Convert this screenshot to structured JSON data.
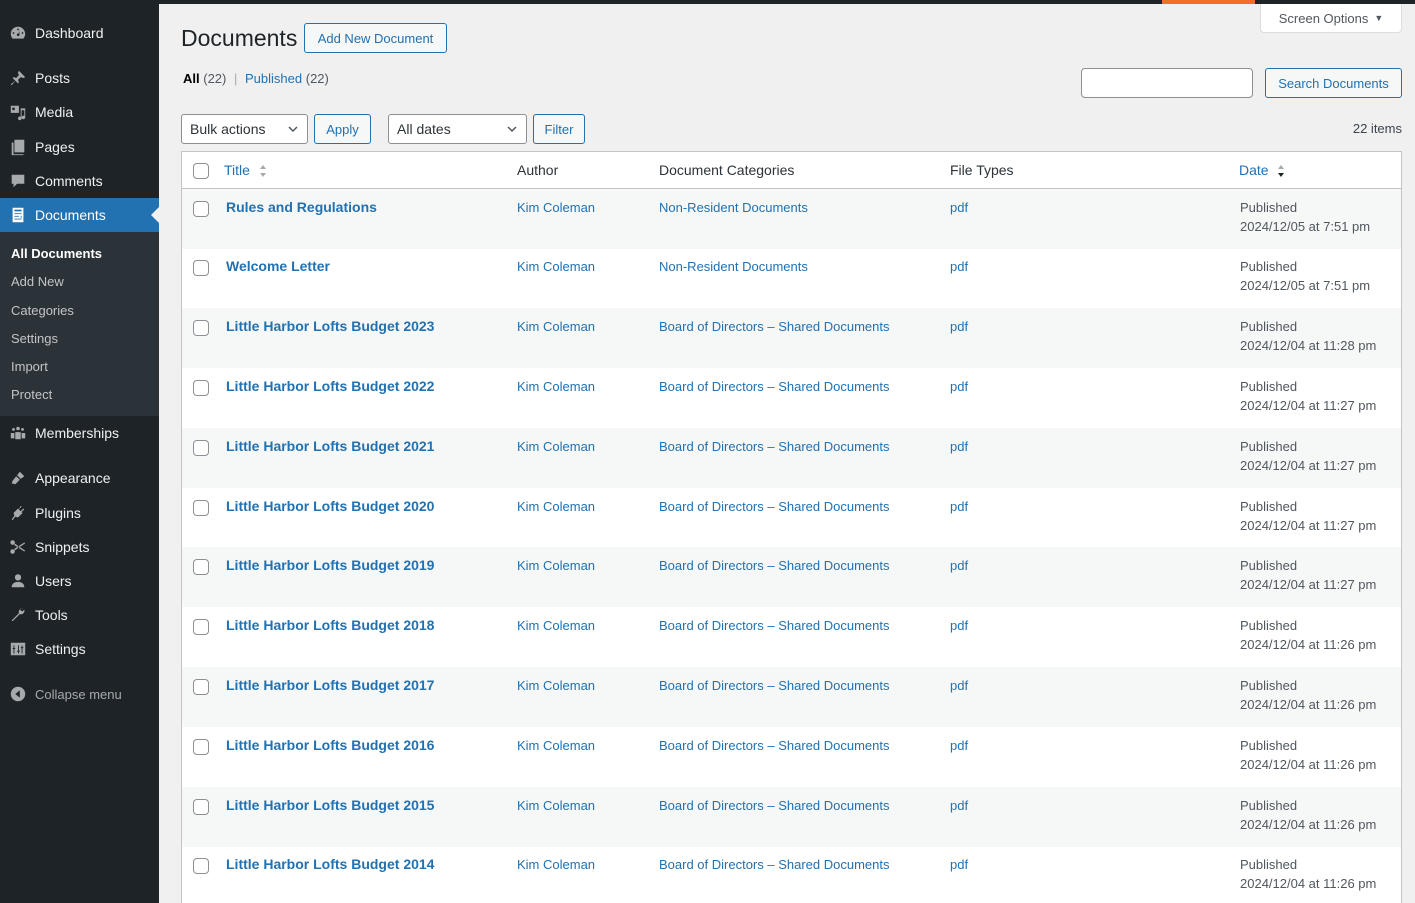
{
  "sidebar": {
    "items": [
      {
        "label": "Dashboard",
        "icon": "dashboard-icon"
      },
      {
        "label": "Posts",
        "icon": "pin-icon"
      },
      {
        "label": "Media",
        "icon": "media-icon"
      },
      {
        "label": "Pages",
        "icon": "pages-icon"
      },
      {
        "label": "Comments",
        "icon": "comment-icon"
      },
      {
        "label": "Documents",
        "icon": "document-icon",
        "current": true
      },
      {
        "label": "Memberships",
        "icon": "groups-icon"
      },
      {
        "label": "Appearance",
        "icon": "paintbrush-icon"
      },
      {
        "label": "Plugins",
        "icon": "plugin-icon"
      },
      {
        "label": "Snippets",
        "icon": "scissors-icon"
      },
      {
        "label": "Users",
        "icon": "user-icon"
      },
      {
        "label": "Tools",
        "icon": "wrench-icon"
      },
      {
        "label": "Settings",
        "icon": "settings-icon"
      }
    ],
    "submenu": [
      {
        "label": "All Documents",
        "current": true
      },
      {
        "label": "Add New"
      },
      {
        "label": "Categories"
      },
      {
        "label": "Settings"
      },
      {
        "label": "Import"
      },
      {
        "label": "Protect"
      }
    ],
    "collapse_label": "Collapse menu"
  },
  "header": {
    "title": "Documents",
    "add_new_label": "Add New Document",
    "screen_options_label": "Screen Options",
    "accent_color": "#f56e28"
  },
  "filters": {
    "all_label": "All",
    "all_count": "(22)",
    "published_label": "Published",
    "published_count": "(22)",
    "separator": "|"
  },
  "search": {
    "value": "",
    "button_label": "Search Documents"
  },
  "tablenav": {
    "bulk_actions": "Bulk actions",
    "apply_label": "Apply",
    "dates": "All dates",
    "filter_label": "Filter",
    "items_count": "22 items"
  },
  "table": {
    "columns": {
      "title": "Title",
      "author": "Author",
      "categories": "Document Categories",
      "file_types": "File Types",
      "date": "Date"
    },
    "rows": [
      {
        "title": "Rules and Regulations",
        "author": "Kim Coleman",
        "category": "Non-Resident Documents",
        "file_type": "pdf",
        "status": "Published",
        "date": "2024/12/05 at 7:51 pm"
      },
      {
        "title": "Welcome Letter",
        "author": "Kim Coleman",
        "category": "Non-Resident Documents",
        "file_type": "pdf",
        "status": "Published",
        "date": "2024/12/05 at 7:51 pm"
      },
      {
        "title": "Little Harbor Lofts Budget 2023",
        "author": "Kim Coleman",
        "category": "Board of Directors – Shared Documents",
        "file_type": "pdf",
        "status": "Published",
        "date": "2024/12/04 at 11:28 pm"
      },
      {
        "title": "Little Harbor Lofts Budget 2022",
        "author": "Kim Coleman",
        "category": "Board of Directors – Shared Documents",
        "file_type": "pdf",
        "status": "Published",
        "date": "2024/12/04 at 11:27 pm"
      },
      {
        "title": "Little Harbor Lofts Budget 2021",
        "author": "Kim Coleman",
        "category": "Board of Directors – Shared Documents",
        "file_type": "pdf",
        "status": "Published",
        "date": "2024/12/04 at 11:27 pm"
      },
      {
        "title": "Little Harbor Lofts Budget 2020",
        "author": "Kim Coleman",
        "category": "Board of Directors – Shared Documents",
        "file_type": "pdf",
        "status": "Published",
        "date": "2024/12/04 at 11:27 pm"
      },
      {
        "title": "Little Harbor Lofts Budget 2019",
        "author": "Kim Coleman",
        "category": "Board of Directors – Shared Documents",
        "file_type": "pdf",
        "status": "Published",
        "date": "2024/12/04 at 11:27 pm"
      },
      {
        "title": "Little Harbor Lofts Budget 2018",
        "author": "Kim Coleman",
        "category": "Board of Directors – Shared Documents",
        "file_type": "pdf",
        "status": "Published",
        "date": "2024/12/04 at 11:26 pm"
      },
      {
        "title": "Little Harbor Lofts Budget 2017",
        "author": "Kim Coleman",
        "category": "Board of Directors – Shared Documents",
        "file_type": "pdf",
        "status": "Published",
        "date": "2024/12/04 at 11:26 pm"
      },
      {
        "title": "Little Harbor Lofts Budget 2016",
        "author": "Kim Coleman",
        "category": "Board of Directors – Shared Documents",
        "file_type": "pdf",
        "status": "Published",
        "date": "2024/12/04 at 11:26 pm"
      },
      {
        "title": "Little Harbor Lofts Budget 2015",
        "author": "Kim Coleman",
        "category": "Board of Directors – Shared Documents",
        "file_type": "pdf",
        "status": "Published",
        "date": "2024/12/04 at 11:26 pm"
      },
      {
        "title": "Little Harbor Lofts Budget 2014",
        "author": "Kim Coleman",
        "category": "Board of Directors – Shared Documents",
        "file_type": "pdf",
        "status": "Published",
        "date": "2024/12/04 at 11:26 pm"
      }
    ]
  }
}
